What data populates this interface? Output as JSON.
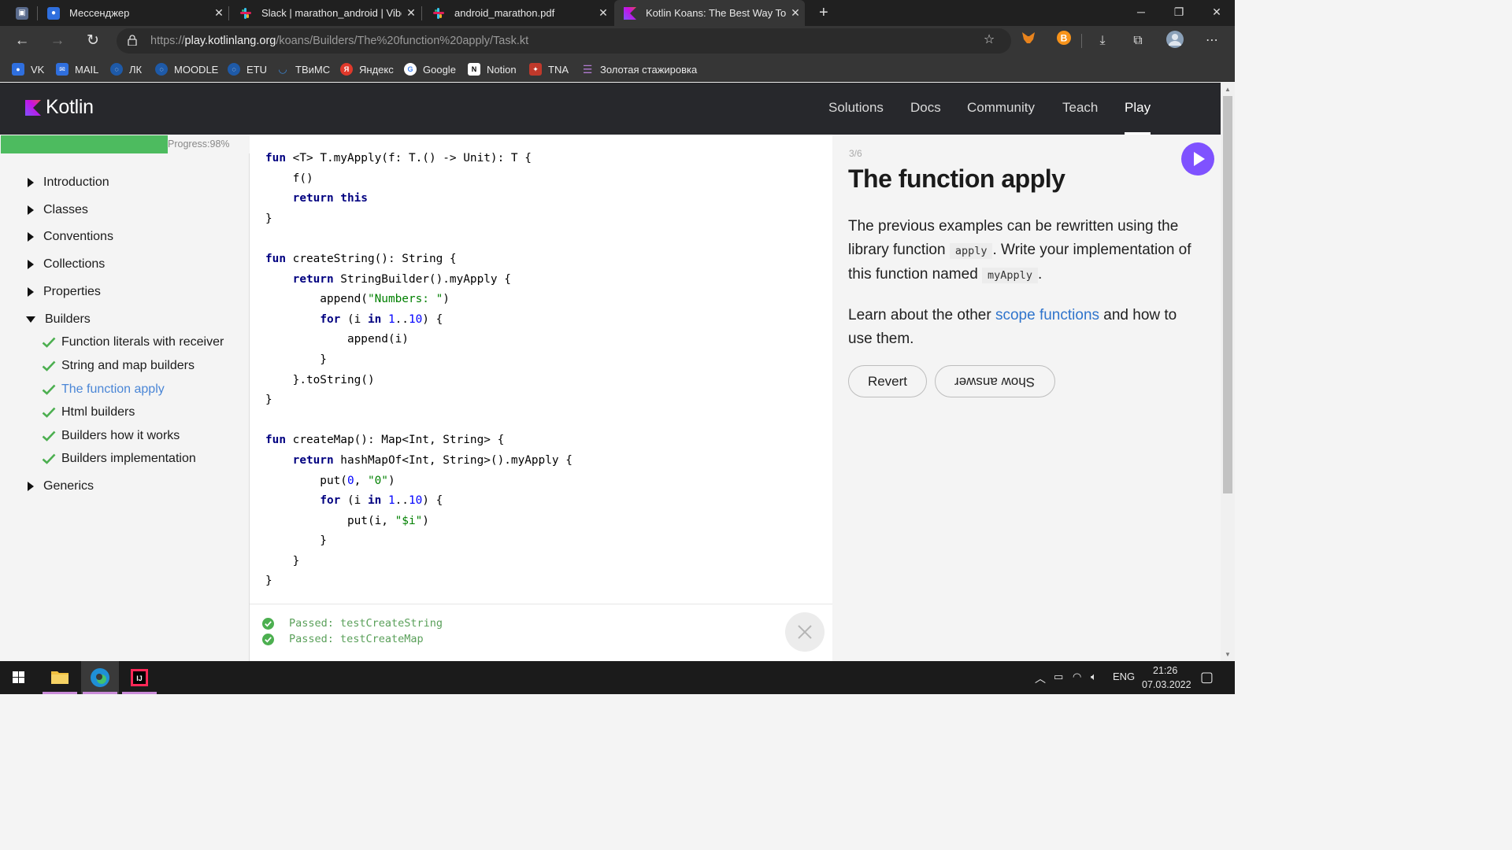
{
  "browser": {
    "tabs": [
      {
        "title": "",
        "icon": "vk-icon"
      },
      {
        "title": "Мессенджер",
        "icon": "messenger-icon"
      },
      {
        "title": "Slack | marathon_android | Vibel",
        "icon": "slack-icon"
      },
      {
        "title": "android_marathon.pdf",
        "icon": "slack-icon"
      },
      {
        "title": "Kotlin Koans: The Best Way To Le",
        "icon": "kotlin-icon",
        "active": true
      }
    ],
    "new_tab": "+",
    "window_controls": {
      "minimize": "─",
      "restore": "❐",
      "close": "✕"
    },
    "url_prefix": "https://",
    "url_host": "play.kotlinlang.org",
    "url_path": "/koans/Builders/The%20function%20apply/Task.kt",
    "bookmarks": [
      {
        "label": "VK",
        "color": "#2f6fde"
      },
      {
        "label": "MAIL",
        "color": "#2f6fde"
      },
      {
        "label": "ЛК",
        "color": "#1e5aa8"
      },
      {
        "label": "MOODLE",
        "color": "#1e5aa8"
      },
      {
        "label": "ETU",
        "color": "#1e5aa8"
      },
      {
        "label": "ТВиМС",
        "color": "#3c87d6"
      },
      {
        "label": "Яндекс",
        "color": "#e0392b"
      },
      {
        "label": "Google",
        "color": "#ffffff"
      },
      {
        "label": "Notion",
        "color": "#ffffff"
      },
      {
        "label": "TNA",
        "color": "#c0392b"
      },
      {
        "label": "Золотая стажировка",
        "color": "#9b59b6"
      }
    ]
  },
  "site": {
    "brand": "Kotlin",
    "nav": [
      "Solutions",
      "Docs",
      "Community",
      "Teach",
      "Play"
    ],
    "active_nav": "Play"
  },
  "sidebar": {
    "progress_label": "Progress:98%",
    "progress_value": 0.98,
    "sections": [
      "Introduction",
      "Classes",
      "Conventions",
      "Collections",
      "Properties",
      "Builders",
      "Generics"
    ],
    "builders_items": [
      "Function literals with receiver",
      "String and map builders",
      "The function apply",
      "Html builders",
      "Builders how it works",
      "Builders implementation"
    ],
    "active_item": "The function apply"
  },
  "console": {
    "results": [
      "Passed: testCreateString",
      "Passed: testCreateMap"
    ]
  },
  "task": {
    "counter": "3/6",
    "title": "The function apply",
    "p1_a": "The previous examples can be rewritten using the library function ",
    "p1_code1": "apply",
    "p1_b": ". Write your implementation of this function named ",
    "p1_code2": "myApply",
    "p1_c": ".",
    "p2_a": "Learn about the other ",
    "p2_link": "scope functions",
    "p2_b": " and how to use them.",
    "revert_label": "Revert",
    "show_answer_label": "Show answer"
  },
  "taskbar": {
    "lang": "ENG",
    "time": "21:26",
    "date": "07.03.2022"
  },
  "colors": {
    "kotlin_purple": "#7f52ff",
    "progress_green": "#4dbb5f",
    "link_blue": "#2f74cc"
  }
}
